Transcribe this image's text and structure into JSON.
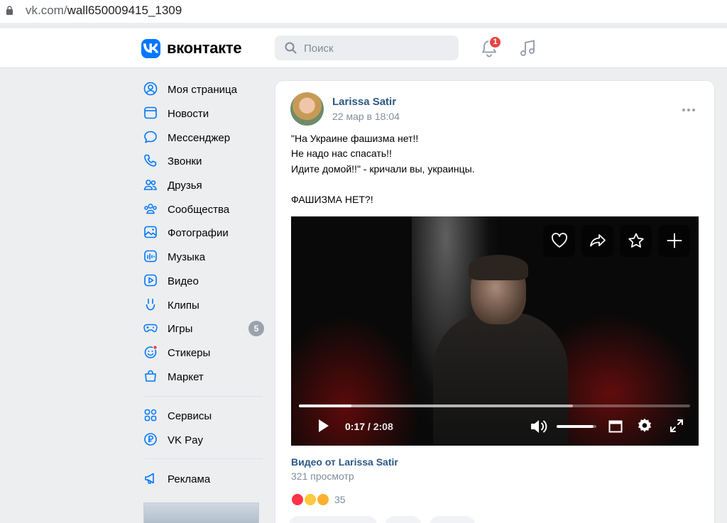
{
  "browser": {
    "url_domain": "vk.com/",
    "url_path": "wall650009415_1309"
  },
  "header": {
    "brand": "вконтакте",
    "search_placeholder": "Поиск",
    "notifications_count": "1"
  },
  "nav": {
    "items": [
      {
        "label": "Моя страница",
        "icon": "user-circle-icon"
      },
      {
        "label": "Новости",
        "icon": "news-icon"
      },
      {
        "label": "Мессенджер",
        "icon": "chat-icon"
      },
      {
        "label": "Звонки",
        "icon": "phone-icon"
      },
      {
        "label": "Друзья",
        "icon": "friends-icon"
      },
      {
        "label": "Сообщества",
        "icon": "communities-icon"
      },
      {
        "label": "Фотографии",
        "icon": "photo-icon"
      },
      {
        "label": "Музыка",
        "icon": "music-icon"
      },
      {
        "label": "Видео",
        "icon": "video-icon"
      },
      {
        "label": "Клипы",
        "icon": "clips-icon"
      },
      {
        "label": "Игры",
        "icon": "gamepad-icon",
        "badge": "5"
      },
      {
        "label": "Стикеры",
        "icon": "sticker-icon"
      },
      {
        "label": "Маркет",
        "icon": "shopping-bag-icon"
      }
    ],
    "services": [
      {
        "label": "Сервисы",
        "icon": "services-icon"
      },
      {
        "label": "VK Pay",
        "icon": "vkpay-icon"
      }
    ],
    "ads": {
      "label": "Реклама",
      "icon": "megaphone-icon"
    }
  },
  "post": {
    "author": "Larissa Satir",
    "date": "22 мар в 18:04",
    "lines": [
      "\"На Украине фашизма нет!!",
      "Не надо нас спасать!!",
      "Идите домой!!\" - кричали вы, украинцы.",
      "ФАШИЗМА НЕТ?!"
    ],
    "video": {
      "current_time": "0:17",
      "duration": "2:08",
      "played_fraction": 0.135,
      "buffered_fraction": 0.7,
      "volume_fraction": 0.92
    },
    "video_title": "Видео от Larissa Satir",
    "video_views": "321 просмотр",
    "reactions_count": "35"
  },
  "colors": {
    "accent": "#0077ff",
    "link": "#2a5885",
    "muted": "#818c99",
    "badge": "#e64646"
  }
}
